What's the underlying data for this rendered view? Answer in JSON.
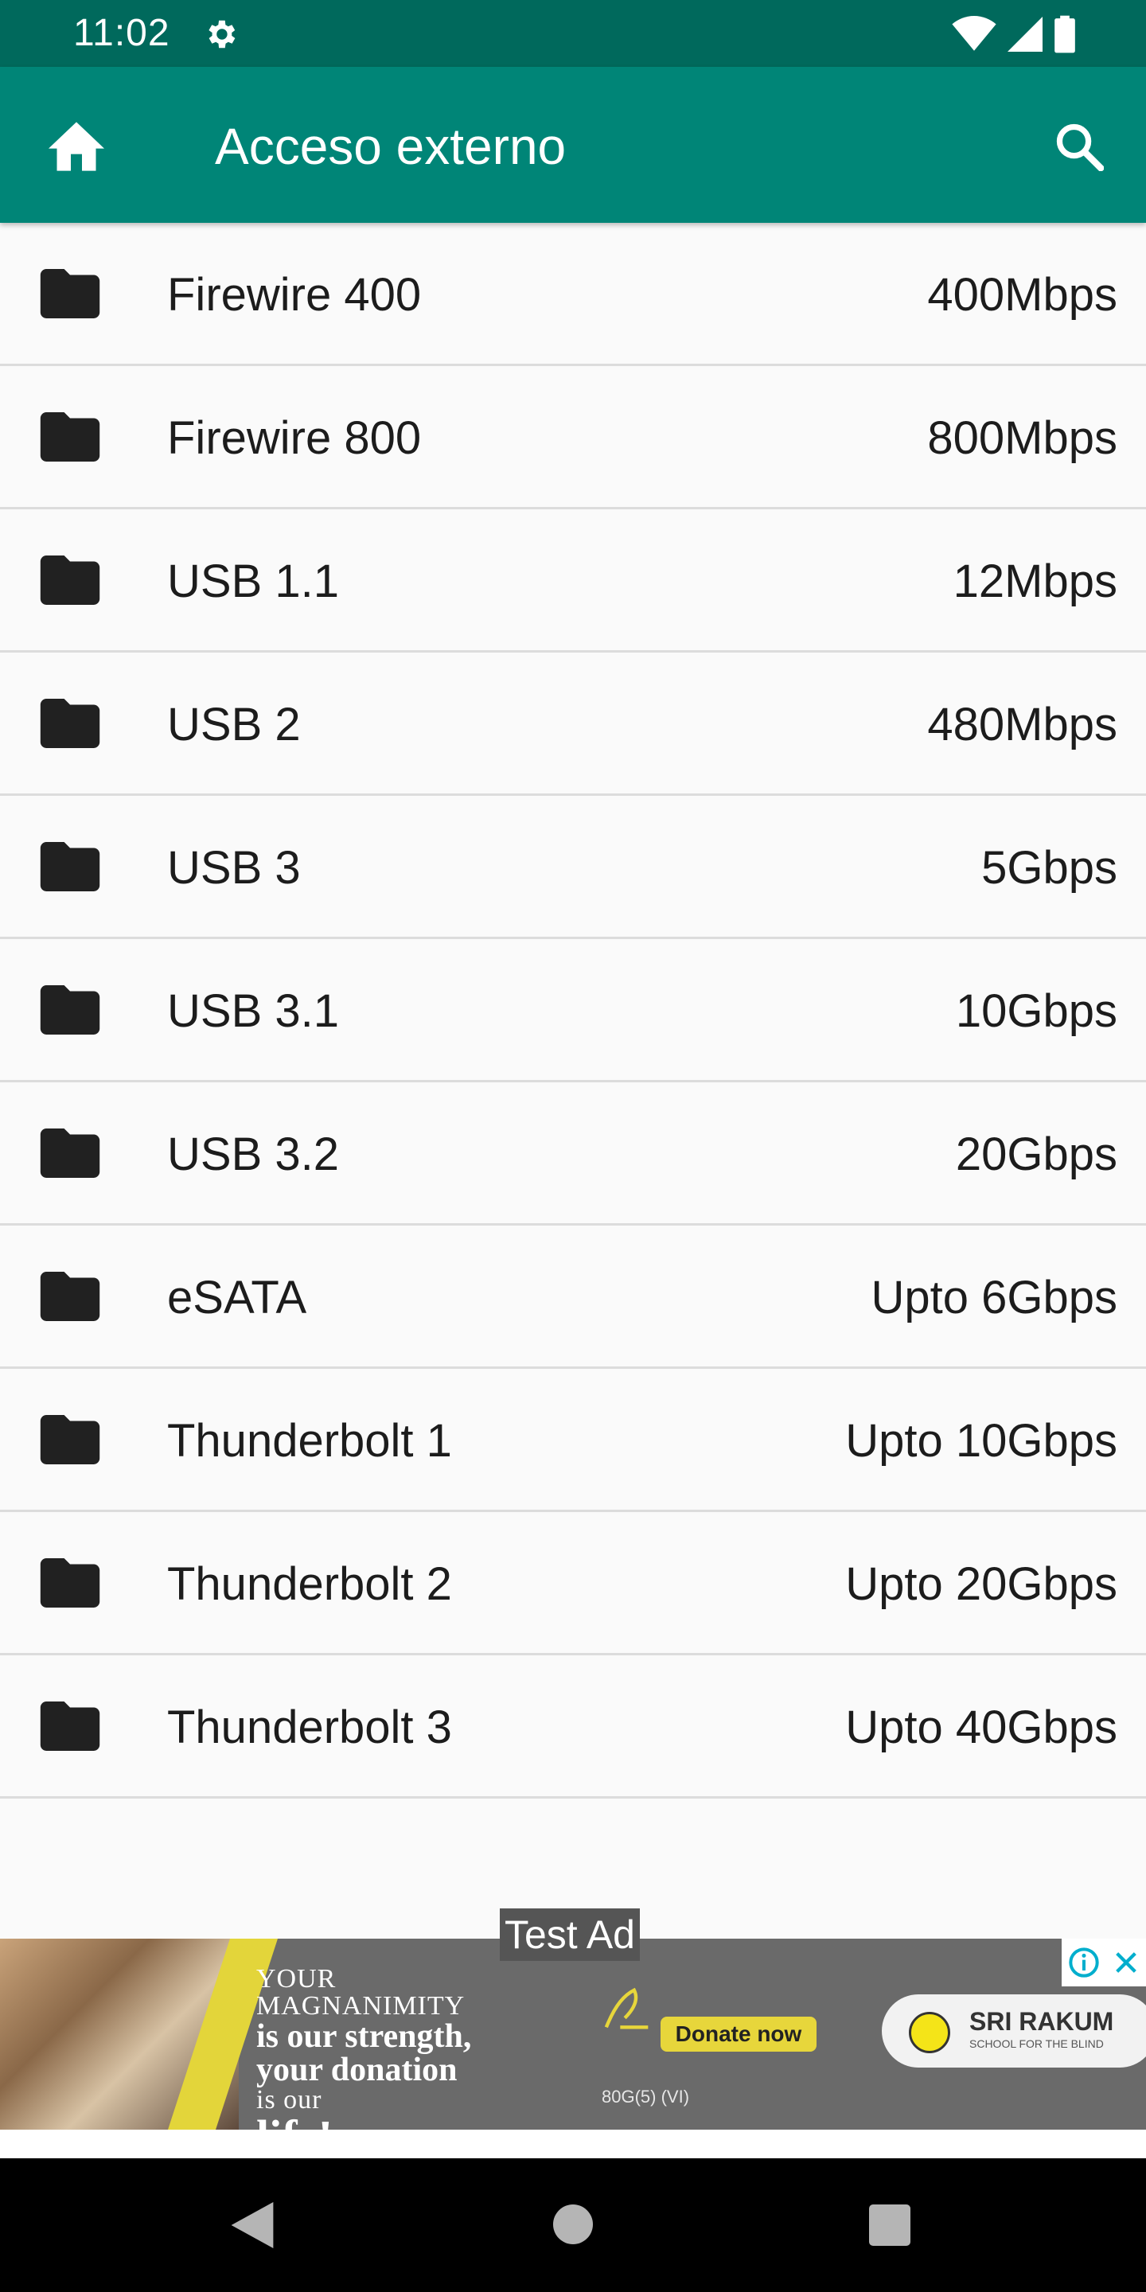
{
  "status_bar": {
    "time": "11:02",
    "icons": [
      "gear-icon",
      "wifi-icon",
      "signal-icon",
      "battery-icon"
    ]
  },
  "app_bar": {
    "title": "Acceso externo",
    "home_icon": "home-icon",
    "search_icon": "search-icon",
    "color": "#008577"
  },
  "list": {
    "items": [
      {
        "name": "Firewire 400",
        "speed": "400Mbps"
      },
      {
        "name": "Firewire 800",
        "speed": "800Mbps"
      },
      {
        "name": "USB 1.1",
        "speed": "12Mbps"
      },
      {
        "name": "USB 2",
        "speed": "480Mbps"
      },
      {
        "name": "USB 3",
        "speed": "5Gbps"
      },
      {
        "name": "USB 3.1",
        "speed": "10Gbps"
      },
      {
        "name": "USB 3.2",
        "speed": "20Gbps"
      },
      {
        "name": "eSATA",
        "speed": "Upto 6Gbps"
      },
      {
        "name": "Thunderbolt 1",
        "speed": "Upto 10Gbps"
      },
      {
        "name": "Thunderbolt 2",
        "speed": "Upto 20Gbps"
      },
      {
        "name": "Thunderbolt 3",
        "speed": "Upto 40Gbps"
      }
    ]
  },
  "ad": {
    "label": "Test Ad",
    "headline_1": "YOUR",
    "headline_2": "MAGNANIMITY",
    "headline_3": "is our strength,",
    "headline_4": "your donation",
    "headline_5": "is our",
    "headline_6": "life!",
    "donate_button": "Donate now",
    "donate_code": "80G(5) (VI)",
    "sponsor_name": "SRI RAKUM",
    "sponsor_tagline": "SCHOOL FOR THE BLIND"
  },
  "nav_bar": {
    "back_icon": "back-icon",
    "home_icon": "home-circle-icon",
    "recents_icon": "recents-icon"
  }
}
